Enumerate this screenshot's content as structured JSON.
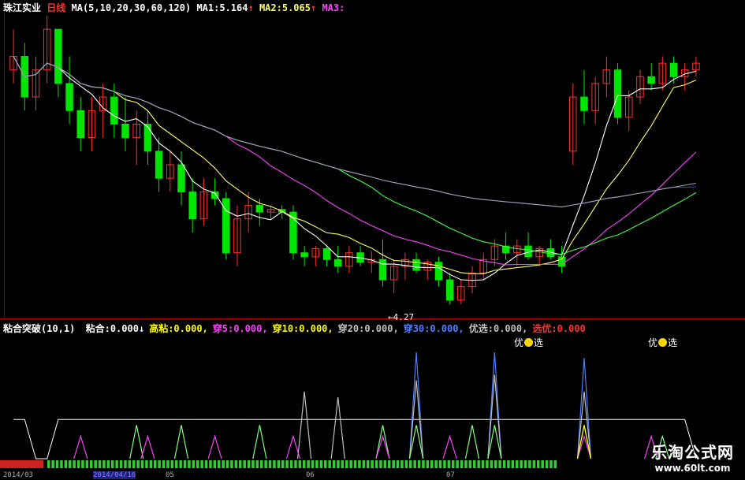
{
  "header": {
    "stock_name": "珠江实业",
    "period": "日线",
    "ma_params": "MA(5,10,20,30,60,120)",
    "ma1_label": "MA1:",
    "ma1_value": "5.164",
    "ma2_label": "MA2:",
    "ma2_value": "5.065",
    "ma3_label": "MA3:",
    "arrow_up": "↑"
  },
  "indicator_header": {
    "name": "粘合突破(10,1)",
    "items": [
      {
        "label": "粘合:",
        "value": "0.000↓",
        "color": "#ffffff"
      },
      {
        "label": "高粘:",
        "value": "0.000,",
        "color": "#ffff00"
      },
      {
        "label": "穿5:",
        "value": "0.000,",
        "color": "#ff40ff"
      },
      {
        "label": "穿10:",
        "value": "0.000,",
        "color": "#ffff00"
      },
      {
        "label": "穿20:",
        "value": "0.000,",
        "color": "#c0c0c0"
      },
      {
        "label": "穿30:",
        "value": "0.000,",
        "color": "#4f7fff"
      },
      {
        "label": "优选:",
        "value": "0.000,",
        "color": "#c0c0c0"
      },
      {
        "label": "选优:",
        "value": "0.000",
        "color": "#ff3030"
      }
    ]
  },
  "optimal_labels": [
    {
      "left": "优",
      "right": "选"
    },
    {
      "left": "优",
      "right": "选"
    }
  ],
  "low_marker": "←4.27",
  "watermark": {
    "title": "乐淘公式网",
    "url": "www.60lt.com"
  },
  "dates": [
    "2014/03",
    "2014/04/16",
    "05",
    "06",
    "07"
  ],
  "colors": {
    "up": "#ff3030",
    "down": "#00e600",
    "ma5": "#ffffff",
    "ma10": "#ffff66",
    "ma20": "#ff40ff",
    "ma30": "#40ff40",
    "ma60": "#2a3fff",
    "ma120": "#a0a0a0"
  },
  "chart_data": [
    {
      "type": "candlestick",
      "title": "珠江实业 日线",
      "series_names": [
        "MA5",
        "MA10",
        "MA20",
        "MA30",
        "MA60",
        "MA120"
      ],
      "ma_values_shown": {
        "MA1": 5.164,
        "MA2": 5.065
      },
      "annotation": {
        "text": "←4.27",
        "value": 4.27
      },
      "ylim": [
        4.2,
        6.4
      ],
      "candles": [
        [
          6.0,
          6.3,
          5.9,
          6.1
        ],
        [
          6.1,
          6.2,
          5.7,
          5.8
        ],
        [
          5.8,
          6.1,
          5.7,
          6.0
        ],
        [
          6.0,
          6.4,
          5.9,
          6.3
        ],
        [
          6.3,
          6.3,
          5.8,
          5.9
        ],
        [
          5.9,
          6.1,
          5.6,
          5.7
        ],
        [
          5.7,
          5.8,
          5.4,
          5.5
        ],
        [
          5.5,
          5.8,
          5.4,
          5.7
        ],
        [
          5.7,
          5.9,
          5.5,
          5.8
        ],
        [
          5.8,
          5.9,
          5.5,
          5.6
        ],
        [
          5.6,
          5.8,
          5.4,
          5.5
        ],
        [
          5.5,
          5.7,
          5.3,
          5.6
        ],
        [
          5.6,
          5.7,
          5.3,
          5.4
        ],
        [
          5.4,
          5.5,
          5.1,
          5.2
        ],
        [
          5.2,
          5.4,
          5.1,
          5.3
        ],
        [
          5.3,
          5.4,
          5.0,
          5.1
        ],
        [
          5.1,
          5.2,
          4.8,
          4.9
        ],
        [
          4.9,
          5.2,
          4.85,
          5.1
        ],
        [
          5.1,
          5.2,
          5.0,
          5.05
        ],
        [
          5.05,
          5.1,
          4.6,
          4.65
        ],
        [
          4.65,
          5.0,
          4.55,
          4.9
        ],
        [
          4.9,
          5.1,
          4.8,
          5.0
        ],
        [
          5.0,
          5.05,
          4.85,
          4.95
        ],
        [
          4.95,
          5.0,
          4.9,
          4.97
        ],
        [
          4.97,
          5.0,
          4.9,
          4.95
        ],
        [
          4.95,
          5.0,
          4.6,
          4.65
        ],
        [
          4.65,
          4.7,
          4.55,
          4.62
        ],
        [
          4.62,
          4.7,
          4.55,
          4.68
        ],
        [
          4.68,
          4.7,
          4.55,
          4.6
        ],
        [
          4.6,
          4.7,
          4.5,
          4.55
        ],
        [
          4.55,
          4.7,
          4.5,
          4.65
        ],
        [
          4.65,
          4.7,
          4.55,
          4.58
        ],
        [
          4.58,
          4.66,
          4.5,
          4.6
        ],
        [
          4.6,
          4.75,
          4.4,
          4.45
        ],
        [
          4.45,
          4.6,
          4.35,
          4.55
        ],
        [
          4.55,
          4.65,
          4.45,
          4.6
        ],
        [
          4.6,
          4.65,
          4.5,
          4.52
        ],
        [
          4.52,
          4.6,
          4.45,
          4.58
        ],
        [
          4.58,
          4.62,
          4.4,
          4.45
        ],
        [
          4.45,
          4.5,
          4.27,
          4.3
        ],
        [
          4.3,
          4.45,
          4.27,
          4.4
        ],
        [
          4.4,
          4.55,
          4.35,
          4.5
        ],
        [
          4.5,
          4.65,
          4.45,
          4.6
        ],
        [
          4.6,
          4.75,
          4.55,
          4.7
        ],
        [
          4.7,
          4.8,
          4.6,
          4.65
        ],
        [
          4.65,
          4.75,
          4.55,
          4.7
        ],
        [
          4.7,
          4.8,
          4.6,
          4.62
        ],
        [
          4.62,
          4.7,
          4.55,
          4.68
        ],
        [
          4.68,
          4.75,
          4.6,
          4.62
        ],
        [
          4.62,
          4.7,
          4.5,
          4.55
        ],
        [
          5.4,
          5.9,
          5.3,
          5.8
        ],
        [
          5.8,
          6.0,
          5.6,
          5.7
        ],
        [
          5.7,
          5.95,
          5.6,
          5.9
        ],
        [
          5.9,
          6.1,
          5.8,
          6.0
        ],
        [
          6.0,
          6.05,
          5.6,
          5.65
        ],
        [
          5.65,
          5.85,
          5.55,
          5.8
        ],
        [
          5.8,
          6.0,
          5.75,
          5.95
        ],
        [
          5.95,
          6.05,
          5.85,
          5.9
        ],
        [
          5.9,
          6.1,
          5.85,
          6.05
        ],
        [
          6.05,
          6.1,
          5.9,
          5.95
        ],
        [
          5.95,
          6.05,
          5.85,
          6.0
        ],
        [
          6.0,
          6.1,
          5.95,
          6.05
        ]
      ]
    },
    {
      "type": "line",
      "title": "粘合突破(10,1)",
      "series": [
        {
          "name": "粘合",
          "values": [
            0.35,
            0.35,
            0.0,
            0.0,
            0.35,
            0.35,
            0.35,
            0.35,
            0.35,
            0.35,
            0.35,
            0.35,
            0.35,
            0.35,
            0.35,
            0.35,
            0.35,
            0.35,
            0.35,
            0.35,
            0.35,
            0.35,
            0.35,
            0.35,
            0.35,
            0.35,
            0.35,
            0.35,
            0.35,
            0.35,
            0.35,
            0.35,
            0.35,
            0.35,
            0.35,
            0.35,
            0.35,
            0.35,
            0.35,
            0.35,
            0.35,
            0.35,
            0.35,
            0.35,
            0.35,
            0.35,
            0.35,
            0.35,
            0.35,
            0.35,
            0.35,
            0.35,
            0.35,
            0.35,
            0.35,
            0.35,
            0.35,
            0.35,
            0.35,
            0.35,
            0.35,
            0.0
          ]
        },
        {
          "name": "穿30",
          "values": [
            0,
            0,
            0,
            0,
            0,
            0,
            0,
            0,
            0,
            0,
            0,
            0,
            0,
            0,
            0,
            0,
            0,
            0,
            0,
            0,
            0,
            0,
            0,
            0,
            0,
            0,
            0,
            0,
            0,
            0,
            0,
            0,
            0,
            0,
            0,
            0,
            0.95,
            0,
            0,
            0,
            0,
            0,
            0,
            0.95,
            0,
            0,
            0,
            0,
            0,
            0,
            0,
            0.9,
            0,
            0,
            0,
            0,
            0,
            0,
            0,
            0,
            0,
            0
          ]
        },
        {
          "name": "穿20",
          "values": [
            0,
            0,
            0,
            0,
            0,
            0,
            0,
            0,
            0,
            0,
            0,
            0,
            0,
            0,
            0,
            0,
            0,
            0,
            0,
            0,
            0,
            0,
            0,
            0,
            0,
            0,
            0.6,
            0,
            0,
            0.55,
            0,
            0,
            0,
            0,
            0,
            0,
            0.7,
            0,
            0,
            0,
            0,
            0,
            0,
            0.75,
            0,
            0,
            0,
            0,
            0,
            0,
            0,
            0.6,
            0,
            0,
            0,
            0,
            0,
            0,
            0,
            0,
            0,
            0
          ]
        },
        {
          "name": "穿10",
          "values": [
            0,
            0,
            0,
            0,
            0,
            0,
            0,
            0,
            0,
            0,
            0,
            0.3,
            0,
            0,
            0,
            0.3,
            0,
            0,
            0,
            0,
            0,
            0,
            0.3,
            0,
            0,
            0,
            0,
            0,
            0,
            0,
            0,
            0,
            0,
            0.3,
            0,
            0,
            0.3,
            0,
            0,
            0,
            0,
            0.3,
            0,
            0.3,
            0,
            0,
            0,
            0,
            0,
            0,
            0,
            0.3,
            0,
            0,
            0,
            0,
            0,
            0,
            0.2,
            0,
            0,
            0
          ]
        },
        {
          "name": "穿5",
          "values": [
            0,
            0,
            0,
            0,
            0,
            0,
            0.2,
            0,
            0,
            0,
            0,
            0,
            0.2,
            0,
            0,
            0,
            0,
            0,
            0.2,
            0,
            0,
            0,
            0,
            0,
            0,
            0.2,
            0,
            0,
            0,
            0,
            0,
            0,
            0,
            0.2,
            0,
            0,
            0,
            0,
            0,
            0.2,
            0,
            0,
            0,
            0,
            0,
            0,
            0,
            0,
            0,
            0,
            0,
            0.2,
            0,
            0,
            0,
            0,
            0,
            0.2,
            0,
            0,
            0,
            0
          ]
        },
        {
          "name": "优选",
          "values": [
            0,
            0,
            0,
            0,
            0,
            0,
            0,
            0,
            0,
            0,
            0,
            0,
            0,
            0,
            0,
            0,
            0,
            0,
            0,
            0,
            0,
            0,
            0,
            0,
            0,
            0,
            0,
            0,
            0,
            0,
            0,
            0,
            0,
            0,
            0,
            0,
            0,
            0,
            0,
            0,
            0,
            0,
            0,
            0,
            0,
            0,
            0,
            0,
            0,
            0,
            0,
            0.3,
            0,
            0,
            0,
            0,
            0,
            0,
            0,
            0,
            0,
            0
          ]
        }
      ],
      "ylim": [
        0,
        1
      ]
    }
  ]
}
